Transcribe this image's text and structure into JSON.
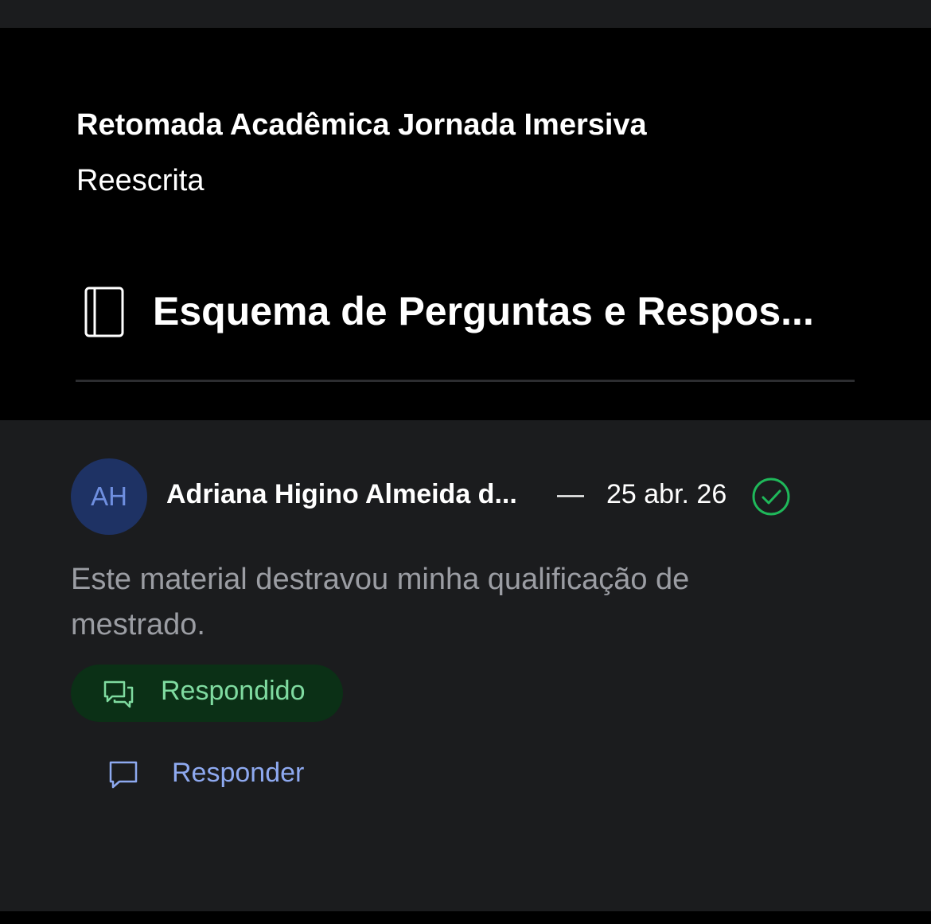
{
  "course": {
    "title": "Retomada Acadêmica Jornada Imersiva",
    "subtitle": "Reescrita"
  },
  "lesson": {
    "icon": "book-icon",
    "title": "Esquema de Perguntas e Respos..."
  },
  "comment": {
    "avatar_initials": "AH",
    "author": "Adriana Higino Almeida d...",
    "separator": "—",
    "date": "25 abr. 26",
    "status_icon": "check-circle-icon",
    "text": "Este material destravou minha qualificação de mestrado."
  },
  "badge": {
    "icon": "chat-bubbles-icon",
    "label": "Respondido"
  },
  "actions": {
    "reply_icon": "chat-bubble-icon",
    "reply_label": "Responder"
  },
  "colors": {
    "background": "#1b1c1e",
    "header_background": "#000000",
    "avatar_background": "#1e3264",
    "avatar_text": "#6f8fe0",
    "success_green": "#1fb85a",
    "badge_background": "#0b3016",
    "badge_text": "#7fdba0",
    "link_blue": "#8ea9f0",
    "muted_text": "#9b9da3"
  }
}
